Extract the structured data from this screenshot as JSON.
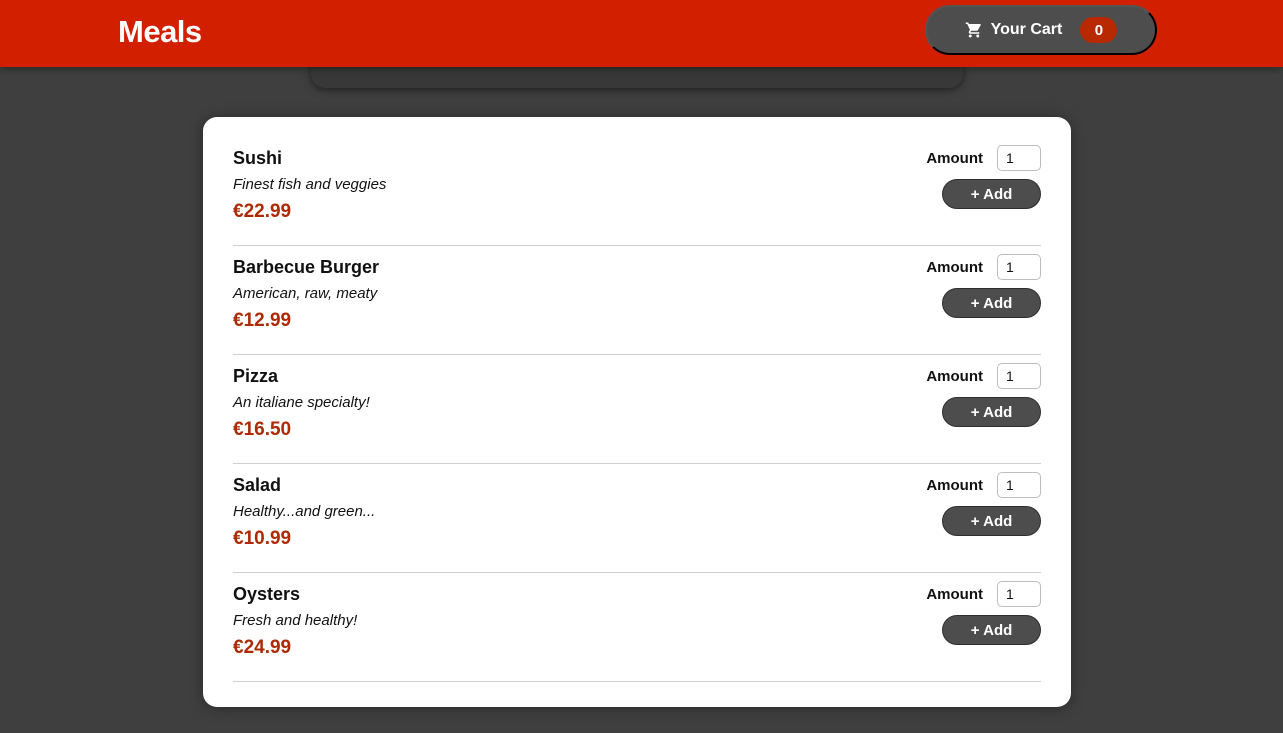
{
  "header": {
    "title": "Meals",
    "cart": {
      "label": "Your Cart",
      "count": "0",
      "icon": "cart-icon"
    }
  },
  "colors": {
    "header_bg": "#d11f00",
    "page_bg": "#3f3f3f",
    "price": "#ad2a05",
    "button_bg": "#4d4d4d"
  },
  "meals": [
    {
      "name": "Sushi",
      "description": "Finest fish and veggies",
      "price": "€22.99",
      "amount_label": "Amount",
      "amount": "1",
      "add_label": "+ Add"
    },
    {
      "name": "Barbecue Burger",
      "description": "American, raw, meaty",
      "price": "€12.99",
      "amount_label": "Amount",
      "amount": "1",
      "add_label": "+ Add"
    },
    {
      "name": "Pizza",
      "description": "An italiane specialty!",
      "price": "€16.50",
      "amount_label": "Amount",
      "amount": "1",
      "add_label": "+ Add"
    },
    {
      "name": "Salad",
      "description": "Healthy...and green...",
      "price": "€10.99",
      "amount_label": "Amount",
      "amount": "1",
      "add_label": "+ Add"
    },
    {
      "name": "Oysters",
      "description": "Fresh and healthy!",
      "price": "€24.99",
      "amount_label": "Amount",
      "amount": "1",
      "add_label": "+ Add"
    }
  ]
}
